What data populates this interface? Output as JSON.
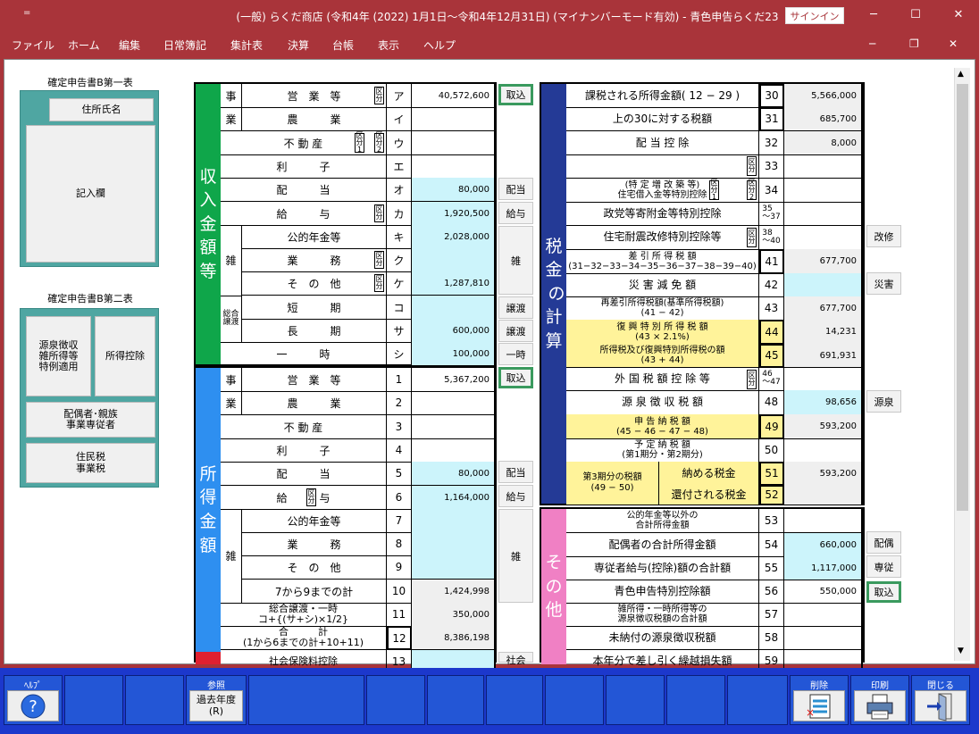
{
  "window": {
    "title": "(一般) らくだ商店 (令和4年 (2022) 1月1日〜令和4年12月31日) (マイナンバーモード有効)  -  青色申告らくだ23",
    "signin": "サインイン",
    "quick_access": "="
  },
  "menu": [
    "ファイル",
    "ホーム",
    "編集",
    "日常簿記",
    "集計表",
    "決算",
    "台帳",
    "表示",
    "ヘルプ"
  ],
  "left": {
    "form1_title": "確定申告書B第一表",
    "address_btn": "住所氏名",
    "entry_btn": "記入欄",
    "form2_title": "確定申告書B第二表",
    "withholding_btn": "源泉徴収\n雑所得等\n特例適用",
    "deduction_btn": "所得控除",
    "spouse_btn": "配偶者･親族\n事業専従者",
    "resident_btn": "住民税\n事業税"
  },
  "income": {
    "band": "収\n入\n金\n額\n等",
    "rows": [
      {
        "label": "営　業　等",
        "code": "ア",
        "value": "40,572,600"
      },
      {
        "label": "農　　　業",
        "code": "イ",
        "value": ""
      },
      {
        "label": "不 動 産",
        "code": "ウ",
        "value": ""
      },
      {
        "label": "利　　　子",
        "code": "エ",
        "value": ""
      },
      {
        "label": "配　　　当",
        "code": "オ",
        "value": "80,000"
      },
      {
        "label": "給　　　与",
        "code": "カ",
        "value": "1,920,500"
      },
      {
        "label": "公的年金等",
        "code": "キ",
        "value": "2,028,000"
      },
      {
        "label": "業　　　務",
        "code": "ク",
        "value": ""
      },
      {
        "label": "そ　の　他",
        "code": "ケ",
        "value": "1,287,810"
      },
      {
        "label": "短　　　期",
        "code": "コ",
        "value": ""
      },
      {
        "label": "長　　　期",
        "code": "サ",
        "value": "600,000"
      },
      {
        "label": "一　　　時",
        "code": "シ",
        "value": "100,000"
      }
    ],
    "jigyo": "事",
    "gyo": "業",
    "zatsu": "雑",
    "sogo": "総合譲渡"
  },
  "shotoku": {
    "band": "所\n得\n金\n額",
    "rows": [
      {
        "label": "営　業　等",
        "code": "1",
        "value": "5,367,200"
      },
      {
        "label": "農　　　業",
        "code": "2",
        "value": ""
      },
      {
        "label": "不 動 産",
        "code": "3",
        "value": ""
      },
      {
        "label": "利　　　子",
        "code": "4",
        "value": ""
      },
      {
        "label": "配　　　当",
        "code": "5",
        "value": "80,000"
      },
      {
        "label": "給　　　与",
        "code": "6",
        "value": "1,164,000"
      },
      {
        "label": "公的年金等",
        "code": "7",
        "value": ""
      },
      {
        "label": "業　　　務",
        "code": "8",
        "value": ""
      },
      {
        "label": "そ　の　他",
        "code": "9",
        "value": ""
      },
      {
        "label": "7から9までの計",
        "code": "10",
        "value": "1,424,998"
      },
      {
        "label": "総合譲渡・一時\nコ+{(サ+シ)×1/2}",
        "code": "11",
        "value": "350,000"
      },
      {
        "label": "合　　　計\n(1から6までの計+10+11)",
        "code": "12",
        "value": "8,386,198"
      },
      {
        "label": "社会保険料控除",
        "code": "13",
        "value": ""
      }
    ],
    "jigyo": "事",
    "gyo": "業",
    "zatsu": "雑"
  },
  "side_buttons_mid": {
    "torikomi1": "取込",
    "haito1": "配当",
    "kyuyo1": "給与",
    "zatsu1": "雑",
    "joto1": "譲渡",
    "joto2": "譲渡",
    "ichiji": "一時",
    "torikomi2": "取込",
    "haito2": "配当",
    "kyuyo2": "給与",
    "zatsu2": "雑",
    "shakai": "社会"
  },
  "tax": {
    "band": "税\n金\n の\n計\n算",
    "rows": [
      {
        "label": "課税される所得金額( 12 − 29 )",
        "code": "30",
        "value": "5,566,000"
      },
      {
        "label": "上の30に対する税額",
        "code": "31",
        "value": "685,700"
      },
      {
        "label": "配 当 控 除",
        "code": "32",
        "value": "8,000"
      },
      {
        "label": "",
        "code": "33",
        "value": ""
      },
      {
        "label": "(特 定 増 改 築 等)\n住宅借入金等特別控除",
        "code": "34",
        "value": ""
      },
      {
        "label": "政党等寄附金等特別控除",
        "code": "35\n〜37",
        "value": ""
      },
      {
        "label": "住宅耐震改修特別控除等",
        "code": "38\n〜40",
        "value": ""
      },
      {
        "label": "差 引 所 得 税 額\n(31−32−33−34−35−36−37−38−39−40)",
        "code": "41",
        "value": "677,700"
      },
      {
        "label": "災 害 減 免 額",
        "code": "42",
        "value": ""
      },
      {
        "label": "再差引所得税額(基準所得税額)\n(41 − 42)",
        "code": "43",
        "value": "677,700"
      },
      {
        "label": "復 興 特 別 所 得 税 額\n(43 × 2.1%)",
        "code": "44",
        "value": "14,231"
      },
      {
        "label": "所得税及び復興特別所得税の額\n(43 + 44)",
        "code": "45",
        "value": "691,931"
      },
      {
        "label": "外 国 税 額 控 除 等",
        "code": "46\n〜47",
        "value": ""
      },
      {
        "label": "源 泉 徴 収 税 額",
        "code": "48",
        "value": "98,656"
      },
      {
        "label": "申 告 納 税 額\n(45 − 46 − 47 − 48)",
        "code": "49",
        "value": "593,200"
      },
      {
        "label": "予 定 納 税 額\n(第1期分・第2期分)",
        "code": "50",
        "value": ""
      },
      {
        "label": "納める税金",
        "code": "51",
        "value": "593,200"
      },
      {
        "label": "還付される税金",
        "code": "52",
        "value": ""
      }
    ],
    "third_period": "第3期分の税額\n(49 − 50)"
  },
  "other": {
    "band": "そ\nの\n他",
    "rows": [
      {
        "label": "公的年金等以外の\n合計所得金額",
        "code": "53",
        "value": ""
      },
      {
        "label": "配偶者の合計所得金額",
        "code": "54",
        "value": "660,000"
      },
      {
        "label": "専従者給与(控除)額の合計額",
        "code": "55",
        "value": "1,117,000"
      },
      {
        "label": "青色申告特別控除額",
        "code": "56",
        "value": "550,000"
      },
      {
        "label": "雑所得・一時所得等の\n源泉徴収税額の合計額",
        "code": "57",
        "value": ""
      },
      {
        "label": "未納付の源泉徴収税額",
        "code": "58",
        "value": ""
      },
      {
        "label": "本年分で差し引く繰越損失額",
        "code": "59",
        "value": ""
      }
    ]
  },
  "side_buttons_right": {
    "torikomi": "取込",
    "kaishu": "改修",
    "saigai": "災害",
    "gensen": "源泉",
    "haigu": "配偶",
    "senju": "専従",
    "torikomi2": "取込"
  },
  "kubun": "区分",
  "kubun1": "区分1",
  "kubun2": "区分2",
  "footer": {
    "help": "ﾍﾙﾌﾟ",
    "ref": "参照",
    "ref_btn": "過去年度\n(R)",
    "delete": "削除",
    "print": "印刷",
    "close": "閉じる"
  }
}
